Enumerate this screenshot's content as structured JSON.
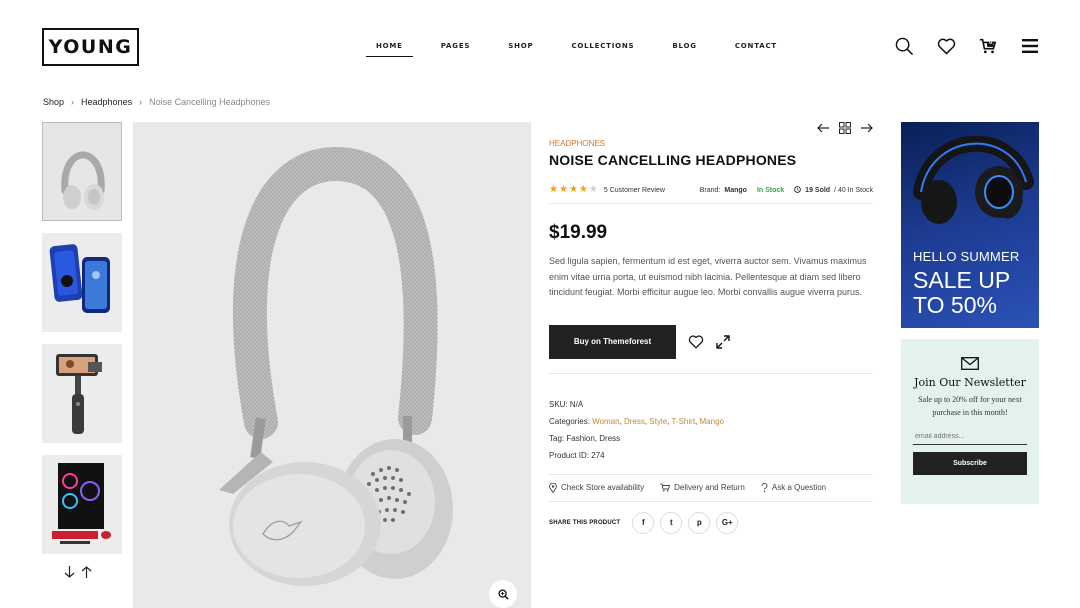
{
  "header": {
    "logo": "YOUNG",
    "nav": [
      "HOME",
      "PAGES",
      "SHOP",
      "COLLECTIONS",
      "BLOG",
      "CONTACT"
    ],
    "active_nav": "HOME",
    "icons": [
      "search-icon",
      "heart-icon",
      "cart-icon",
      "menu-icon"
    ],
    "cart_count": "0"
  },
  "breadcrumb": {
    "items": [
      "Shop",
      "Headphones"
    ],
    "current": "Noise Cancelling Headphones"
  },
  "thumbnails": [
    "headphones",
    "phone-case",
    "phone-gimbal",
    "gaming-pc"
  ],
  "product": {
    "category": "HEADPHONES",
    "title": "NOISE CANCELLING HEADPHONES",
    "rating": 4,
    "rating_max": 5,
    "review_text": "5 Customer Review",
    "brand_label": "Brand:",
    "brand": "Mango",
    "stock": "In Stock",
    "sold": "19 Sold",
    "stock_total": "/ 40 In Stock",
    "price": "$19.99",
    "description": "Sed ligula sapien, fermentum id est eget, viverra auctor sem. Vivamus maximus enim vitae urna porta, ut euismod nibh lacinia. Pellentesque at diam sed libero tincidunt feugiat. Morbi efficitur augue leo. Morbi convallis augue viverra purus.",
    "buy_label": "Buy on Themeforest",
    "sku_label": "SKU:",
    "sku": "N/A",
    "categories_label": "Categories:",
    "categories": [
      "Woman",
      "Dress",
      "Style",
      "T-Shirt",
      "Mango"
    ],
    "tag_label": "Tag:",
    "tags": "Fashion, Dress",
    "product_id_label": "Product ID:",
    "product_id": "274",
    "links": [
      "Check Store availability",
      "Delivery and Return",
      "Ask a Question"
    ],
    "share_label": "SHARE THIS PRODUCT",
    "share": [
      "f",
      "t",
      "p",
      "G+"
    ]
  },
  "banner": {
    "hello": "HELLO SUMMER",
    "sale_line1": "SALE UP",
    "sale_line2": "TO 50%"
  },
  "newsletter": {
    "title": "Join Our Newsletter",
    "text": "Sale up to 20% off for your next purchase in this month!",
    "placeholder": "email address...",
    "button": "Subscribe"
  },
  "colors": {
    "accent_orange": "#d2772e",
    "in_stock_green": "#3aa64a",
    "star": "#f0a21a",
    "dark_button": "#222222",
    "newsletter_bg": "#e4f2ec"
  }
}
